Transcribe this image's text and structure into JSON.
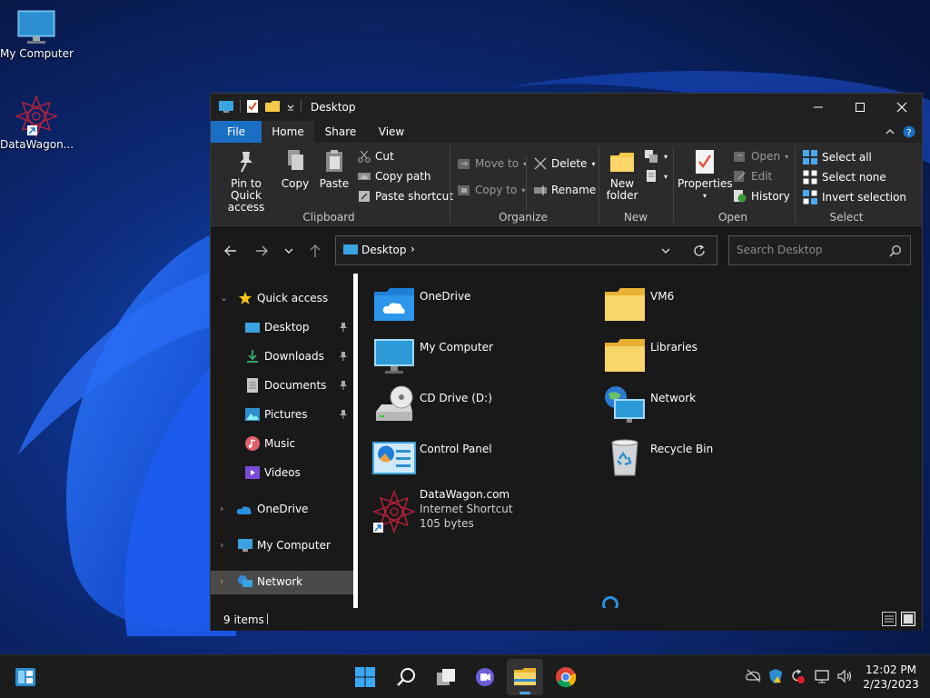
{
  "desktop": {
    "icons": [
      {
        "label": "My Computer",
        "icon": "monitor-icon"
      },
      {
        "label": "DataWagon...",
        "icon": "datawagon-logo-icon"
      }
    ]
  },
  "window": {
    "title": "Desktop",
    "ribbon_tabs": [
      "File",
      "Home",
      "Share",
      "View"
    ],
    "groups": {
      "clipboard": {
        "label": "Clipboard",
        "pin": "Pin to Quick access",
        "copy": "Copy",
        "paste": "Paste",
        "cut": "Cut",
        "copy_path": "Copy path",
        "paste_shortcut": "Paste shortcut"
      },
      "organize": {
        "label": "Organize",
        "move_to": "Move to",
        "copy_to": "Copy to",
        "delete": "Delete",
        "rename": "Rename"
      },
      "new": {
        "label": "New",
        "new_folder": "New folder"
      },
      "open": {
        "label": "Open",
        "properties": "Properties",
        "open": "Open",
        "edit": "Edit",
        "history": "History"
      },
      "select": {
        "label": "Select",
        "select_all": "Select all",
        "select_none": "Select none",
        "invert": "Invert selection"
      }
    },
    "address": {
      "crumb": "Desktop",
      "separator": "›"
    },
    "search": {
      "placeholder": "Search Desktop"
    },
    "nav": {
      "quick_access": "Quick access",
      "pinned": [
        {
          "label": "Desktop",
          "icon": "desktop-folder-icon"
        },
        {
          "label": "Downloads",
          "icon": "download-icon"
        },
        {
          "label": "Documents",
          "icon": "document-icon"
        },
        {
          "label": "Pictures",
          "icon": "pictures-icon"
        },
        {
          "label": "Music",
          "icon": "music-icon"
        },
        {
          "label": "Videos",
          "icon": "video-icon"
        }
      ],
      "roots": [
        {
          "label": "OneDrive",
          "icon": "cloud-icon"
        },
        {
          "label": "My Computer",
          "icon": "monitor-icon"
        },
        {
          "label": "Network",
          "icon": "network-icon"
        }
      ]
    },
    "files": [
      {
        "name": "OneDrive",
        "icon": "onedrive-folder-icon"
      },
      {
        "name": "VM6",
        "icon": "folder-icon"
      },
      {
        "name": "My Computer",
        "icon": "monitor-icon"
      },
      {
        "name": "Libraries",
        "icon": "folder-icon"
      },
      {
        "name": "CD Drive (D:)",
        "icon": "cd-drive-icon"
      },
      {
        "name": "Network",
        "icon": "network-icon"
      },
      {
        "name": "Control Panel",
        "icon": "control-panel-icon"
      },
      {
        "name": "Recycle Bin",
        "icon": "recycle-bin-icon"
      },
      {
        "name": "DataWagon.com",
        "type": "Internet Shortcut",
        "size": "105 bytes",
        "icon": "datawagon-logo-icon"
      }
    ],
    "status": {
      "items": "9 items"
    }
  },
  "taskbar": {
    "clock_time": "12:02 PM",
    "clock_date": "2/23/2023"
  },
  "colors": {
    "accent": "#0078d4",
    "folder": "#f8c84a",
    "file_tab": "#1a6fc4"
  }
}
